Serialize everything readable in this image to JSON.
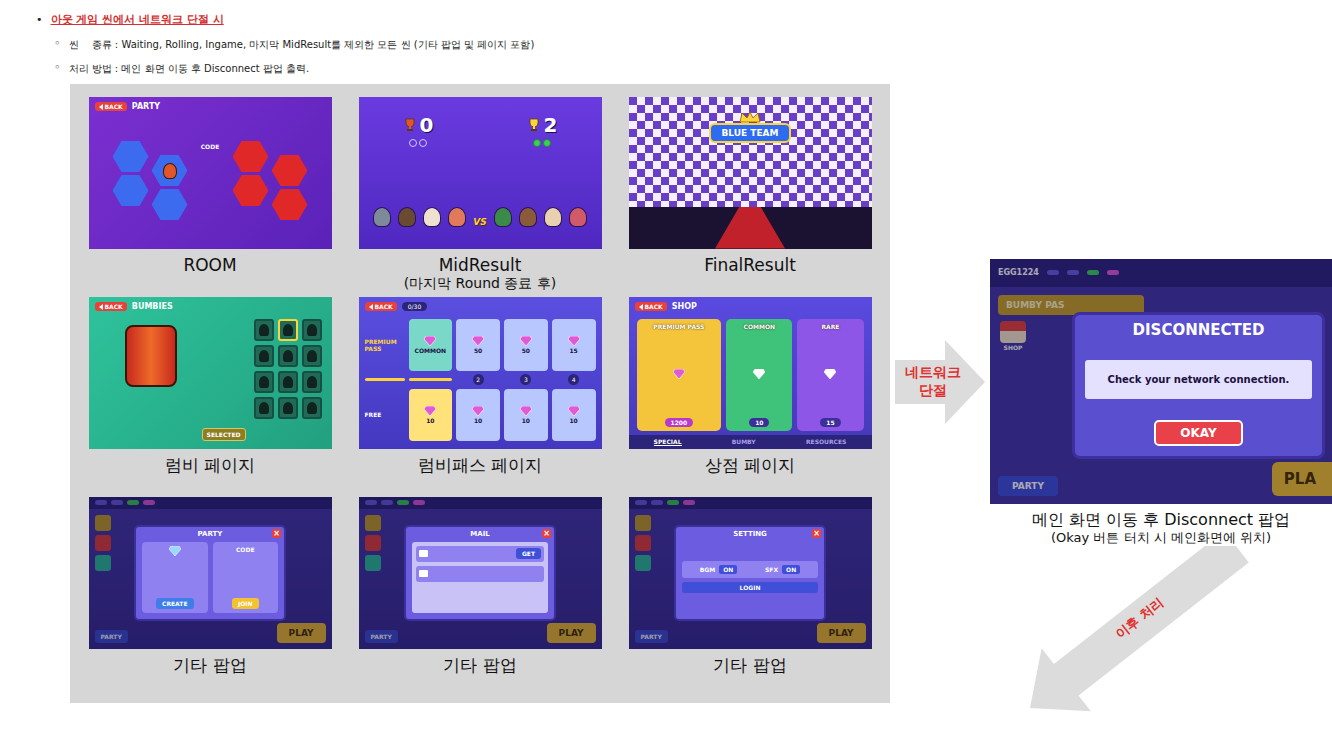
{
  "section": {
    "bullet": "•",
    "title": "아웃 게임 씬에서 네트워크 단절 시",
    "details": [
      {
        "bullet": "◦",
        "text": "씬 　종류 : Waiting, Rolling, Ingame, 마지막 MidResult를 제외한 모든 씬 (기타 팝업 및 페이지 포함)"
      },
      {
        "bullet": "◦",
        "text": "처리 방법 : 메인 화면 이동 후 Disconnect 팝업 출력."
      }
    ]
  },
  "scenes": [
    {
      "kind": "room",
      "caption": [
        "ROOM"
      ],
      "back": "BACK",
      "title": "PARTY",
      "code": "CODE"
    },
    {
      "kind": "midresult",
      "caption": [
        "MidResult",
        "(마지막 Round 종료 후)"
      ],
      "vs": "VS",
      "teams": [
        {
          "score": "0",
          "wins": [
            false,
            false
          ]
        },
        {
          "score": "2",
          "wins": [
            true,
            true
          ]
        }
      ]
    },
    {
      "kind": "finalresult",
      "caption": [
        "FinalResult"
      ],
      "banner": "BLUE TEAM"
    },
    {
      "kind": "bumbies",
      "caption": [
        "럼비 페이지"
      ],
      "back": "BACK",
      "title": "BUMBIES",
      "button": "SELECTED",
      "slots": [
        {
          "selected": false
        },
        {
          "selected": true
        },
        {
          "selected": false
        },
        {
          "selected": false
        },
        {
          "selected": false
        },
        {
          "selected": false
        },
        {
          "selected": false
        },
        {
          "selected": false
        },
        {
          "selected": false
        },
        {
          "selected": false
        },
        {
          "selected": false
        },
        {
          "selected": false
        }
      ]
    },
    {
      "kind": "pass",
      "caption": [
        "럼비패스 페이지"
      ],
      "back": "BACK",
      "progress": "0/30",
      "premium": "PREMIUM PASS",
      "free": "FREE",
      "rewards": [
        "COMMON",
        "50",
        "50",
        "15"
      ],
      "steps": [
        "2",
        "3",
        "4"
      ],
      "freeRewards": [
        "10",
        "10",
        "10",
        "10"
      ]
    },
    {
      "kind": "shop",
      "caption": [
        "상점 페이지"
      ],
      "back": "BACK",
      "title": "SHOP",
      "offers": [
        {
          "kind": "premium",
          "title": "PREMIUM PASS",
          "price": "1200"
        },
        {
          "kind": "common",
          "title": "COMMON",
          "price": "10"
        },
        {
          "kind": "rare",
          "title": "RARE",
          "price": "15"
        }
      ],
      "tabs": [
        {
          "label": "SPECIAL",
          "selected": true
        },
        {
          "label": "BUMBY",
          "selected": false
        },
        {
          "label": "RESOURCES",
          "selected": false
        }
      ]
    },
    {
      "kind": "popup",
      "caption": [
        "기타 팝업"
      ],
      "party": "PARTY",
      "play": "PLAY",
      "popup": {
        "kind": "party",
        "title": "PARTY",
        "close": "×",
        "code": "CODE",
        "buttons": [
          {
            "label": "CREATE",
            "color": "#3f7de8"
          },
          {
            "label": "JOIN",
            "color": "#f2c230"
          }
        ]
      }
    },
    {
      "kind": "popup",
      "caption": [
        "기타 팝업"
      ],
      "party": "PARTY",
      "play": "PLAY",
      "popup": {
        "kind": "mail",
        "title": "MAIL",
        "close": "×",
        "rows": [
          {
            "button": "GET"
          },
          {}
        ]
      }
    },
    {
      "kind": "popup",
      "caption": [
        "기타 팝업"
      ],
      "party": "PARTY",
      "play": "PLAY",
      "popup": {
        "kind": "setting",
        "title": "SETTING",
        "close": "×",
        "toggles": [
          {
            "label": "BGM",
            "value": "ON",
            "on": true
          },
          {
            "label": "SFX",
            "value": "ON",
            "on": true
          }
        ],
        "buttons": [
          {
            "label": "LOGIN",
            "color": "#3f4fd8"
          }
        ]
      }
    }
  ],
  "arrow": {
    "lines": [
      "네트워크",
      "단절"
    ]
  },
  "result": {
    "user": "EGG1224",
    "pass": "BUMBY PAS",
    "shop": "SHOP",
    "party": "PARTY",
    "play": "PLA",
    "dialog": {
      "title": "DISCONNECTED",
      "message": "Check your network connection.",
      "button": "OKAY"
    },
    "caption": [
      "메인 화면 이동 후 Disconnect 팝업",
      "(Okay 버튼 터치 시 메인화면에 위치)"
    ]
  },
  "next": {
    "label": "이후 처리"
  }
}
